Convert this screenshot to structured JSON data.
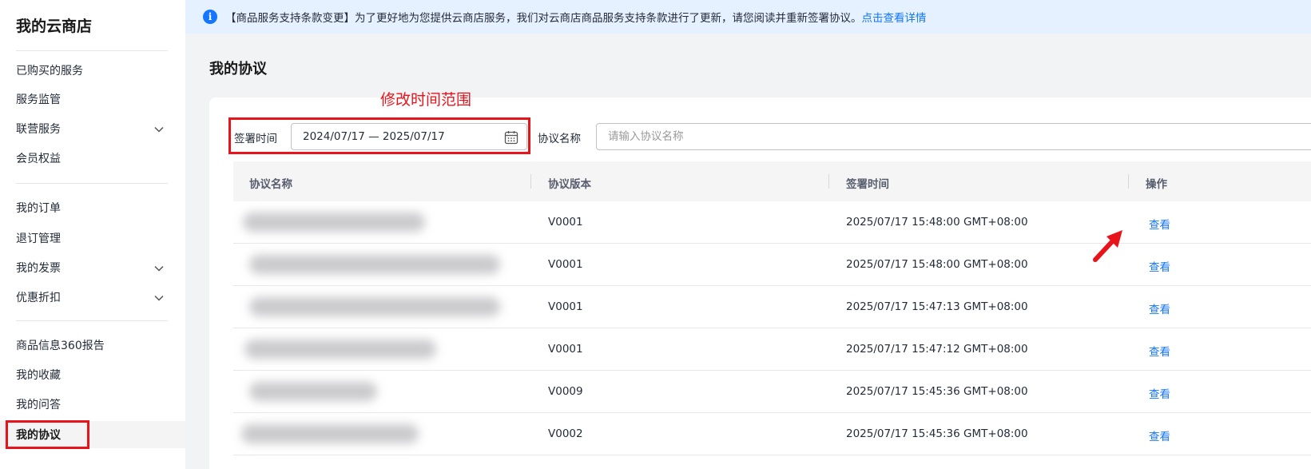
{
  "sidebar": {
    "title": "我的云商店",
    "items": [
      {
        "label": "已购买的服务"
      },
      {
        "label": "服务监管"
      },
      {
        "label": "联营服务"
      },
      {
        "label": "会员权益"
      },
      {
        "label": "我的订单"
      },
      {
        "label": "退订管理"
      },
      {
        "label": "我的发票"
      },
      {
        "label": "优惠折扣"
      },
      {
        "label": "商品信息360报告"
      },
      {
        "label": "我的收藏"
      },
      {
        "label": "我的问答"
      },
      {
        "label": "我的协议"
      }
    ]
  },
  "notice": {
    "icon": "info-icon",
    "text": "【商品服务支持条款变更】为了更好地为您提供云商店服务，我们对云商店商品服务支持条款进行了更新，请您阅读并重新签署协议。",
    "link": "点击查看详情"
  },
  "page": {
    "title": "我的协议"
  },
  "annotation": {
    "label": "修改时间范围",
    "color": "#e8141b"
  },
  "filters": {
    "sign_time_label": "签署时间",
    "date_range": "2024/07/17 — 2025/07/17",
    "name_label": "协议名称",
    "name_placeholder": "请输入协议名称"
  },
  "table": {
    "headers": [
      "协议名称",
      "协议版本",
      "签署时间",
      "操作"
    ],
    "rows": [
      {
        "version": "V0001",
        "time": "2025/07/17 15:48:00 GMT+08:00",
        "action": "查看"
      },
      {
        "version": "V0001",
        "time": "2025/07/17 15:48:00 GMT+08:00",
        "action": "查看"
      },
      {
        "version": "V0001",
        "time": "2025/07/17 15:47:13 GMT+08:00",
        "action": "查看"
      },
      {
        "version": "V0001",
        "time": "2025/07/17 15:47:12 GMT+08:00",
        "action": "查看"
      },
      {
        "version": "V0009",
        "time": "2025/07/17 15:45:36 GMT+08:00",
        "action": "查看"
      },
      {
        "version": "V0002",
        "time": "2025/07/17 15:45:36 GMT+08:00",
        "action": "查看"
      }
    ]
  },
  "colors": {
    "accent": "#1476ff",
    "notice_bg": "#e5f1ff",
    "annotation": "#e8141b"
  }
}
